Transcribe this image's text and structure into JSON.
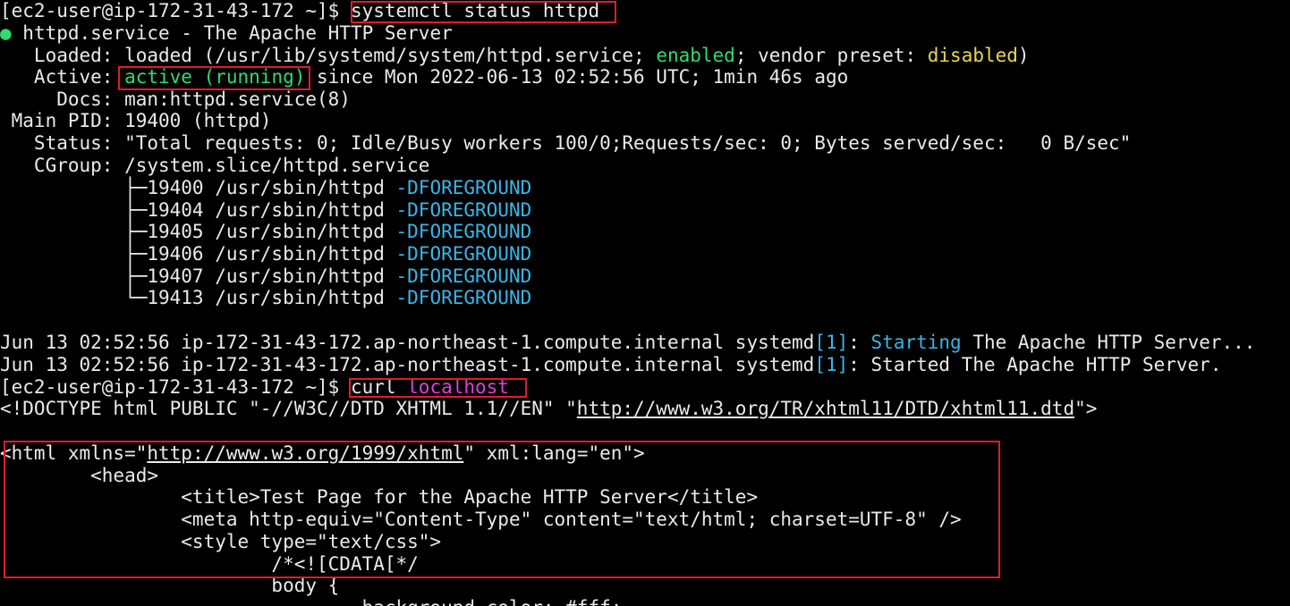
{
  "terminal": {
    "colors": {
      "background": "#000000",
      "foreground": "#eaeaea",
      "green": "#2fdc6e",
      "yellow": "#e6d94a",
      "cyan": "#39b6e8",
      "magenta": "#e03fd8",
      "highlight": "#e11b2d"
    },
    "l1": {
      "prompt": "[ec2-user@ip-172-31-43-172 ~]$ ",
      "cmd": "systemctl status httpd"
    },
    "l2": {
      "dot": "●",
      "text": " httpd.service - The Apache HTTP Server"
    },
    "l3": {
      "a": "   Loaded: loaded (/usr/lib/systemd/system/httpd.service; ",
      "enabled": "enabled",
      "b": "; vendor preset: ",
      "disabled": "disabled",
      "c": ")"
    },
    "l4": {
      "a": "   Active: ",
      "state": "active (running)",
      "b": " since Mon 2022-06-13 02:52:56 UTC; 1min 46s ago"
    },
    "l5": {
      "text": "     Docs: man:httpd.service(8)"
    },
    "l6": {
      "text": " Main PID: 19400 (httpd)"
    },
    "l7": {
      "text": "   Status: \"Total requests: 0; Idle/Busy workers 100/0;Requests/sec: 0; Bytes served/sec:   0 B/sec\""
    },
    "l8": {
      "text": "   CGroup: /system.slice/httpd.service"
    },
    "cgroup": [
      {
        "prefix": "           ├─19400 /usr/sbin/httpd ",
        "flag": "-DFOREGROUND"
      },
      {
        "prefix": "           ├─19404 /usr/sbin/httpd ",
        "flag": "-DFOREGROUND"
      },
      {
        "prefix": "           ├─19405 /usr/sbin/httpd ",
        "flag": "-DFOREGROUND"
      },
      {
        "prefix": "           ├─19406 /usr/sbin/httpd ",
        "flag": "-DFOREGROUND"
      },
      {
        "prefix": "           ├─19407 /usr/sbin/httpd ",
        "flag": "-DFOREGROUND"
      },
      {
        "prefix": "           └─19413 /usr/sbin/httpd ",
        "flag": "-DFOREGROUND"
      }
    ],
    "log1": {
      "a": "Jun 13 02:52:56 ip-172-31-43-172.ap-northeast-1.compute.internal systemd",
      "pid": "[1]",
      "b": ": ",
      "starting": "Starting",
      "c": " The Apache HTTP Server..."
    },
    "log2": {
      "a": "Jun 13 02:52:56 ip-172-31-43-172.ap-northeast-1.compute.internal systemd",
      "pid": "[1]",
      "b": ": Started The Apache HTTP Server."
    },
    "l17": {
      "prompt": "[ec2-user@ip-172-31-43-172 ~]$ ",
      "curl": "curl ",
      "host": "localhost"
    },
    "l18": {
      "a": "<!DOCTYPE html PUBLIC \"-//W3C//DTD XHTML 1.1//EN\" \"",
      "url": "http://www.w3.org/TR/xhtml11/DTD/xhtml11.dtd",
      "b": "\">"
    },
    "l20": {
      "a": "<html xmlns=\"",
      "url": "http://www.w3.org/1999/xhtml",
      "b": "\" xml:lang=\"en\">"
    },
    "l21": {
      "text": "        <head>"
    },
    "l22": {
      "text": "                <title>Test Page for the Apache HTTP Server</title>"
    },
    "l23": {
      "text": "                <meta http-equiv=\"Content-Type\" content=\"text/html; charset=UTF-8\" />"
    },
    "l24": {
      "text": "                <style type=\"text/css\">"
    },
    "l25": {
      "text": "                        /*<![CDATA[*/"
    },
    "l26": {
      "text": "                        body {"
    },
    "l27": {
      "text": "                                background-color: #fff;"
    }
  }
}
